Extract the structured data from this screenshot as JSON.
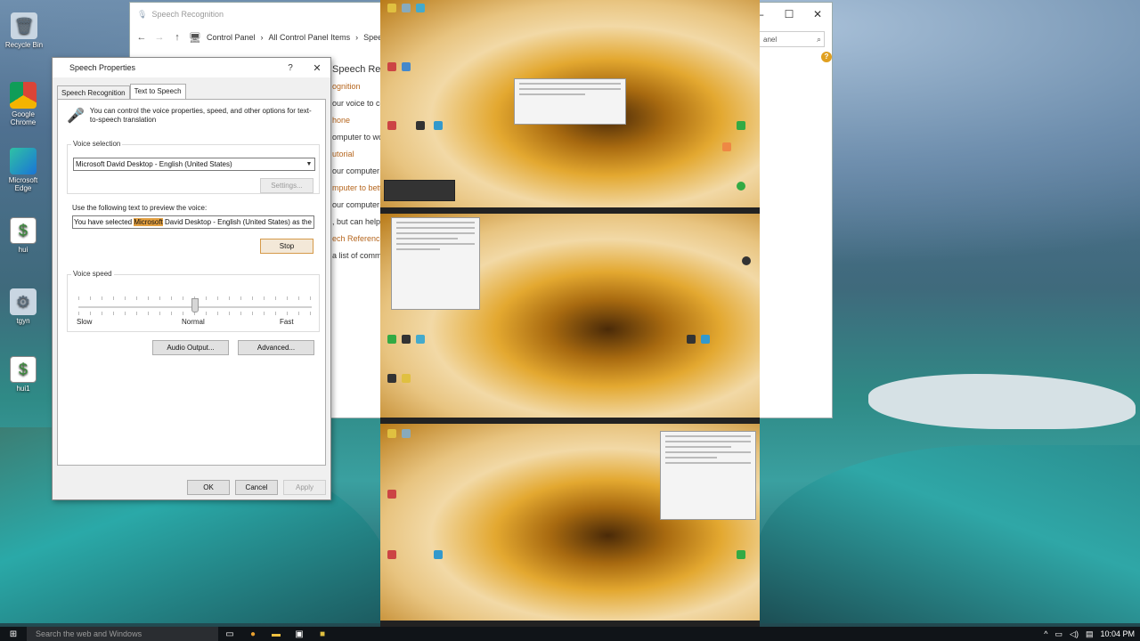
{
  "desktop": {
    "icons": [
      {
        "label": "Recycle Bin",
        "glyph": "🗑"
      },
      {
        "label": "Google Chrome",
        "glyph": ""
      },
      {
        "label": "Microsoft Edge",
        "glyph": ""
      },
      {
        "label": "hui",
        "glyph": "$"
      },
      {
        "label": "tgyn",
        "glyph": "⚙"
      },
      {
        "label": "hui1",
        "glyph": "$"
      }
    ]
  },
  "control_panel": {
    "title": "Speech Recognition",
    "breadcrumb": [
      "Control Panel",
      "All Control Panel Items",
      "Speech"
    ],
    "search_placeholder": "anel",
    "links": [
      {
        "text": "Speech Reco",
        "kind": "hd"
      },
      {
        "text": "ognition",
        "kind": "lk"
      },
      {
        "text": "our voice to contr",
        "kind": "tx"
      },
      {
        "text": "hone",
        "kind": "lk"
      },
      {
        "text": "omputer to work",
        "kind": "tx"
      },
      {
        "text": "utorial",
        "kind": "lk"
      },
      {
        "text": "our computer w",
        "kind": "tx"
      },
      {
        "text": "mputer to better",
        "kind": "lk"
      },
      {
        "text": "our computer to",
        "kind": "tx"
      },
      {
        "text": ", but can help i",
        "kind": "tx"
      },
      {
        "text": "ech Reference C",
        "kind": "lk"
      },
      {
        "text": "a list of comm",
        "kind": "tx"
      }
    ]
  },
  "speech_properties": {
    "title": "Speech Properties",
    "help": "?",
    "close": "✕",
    "tabs": [
      "Speech Recognition",
      "Text to Speech"
    ],
    "active_tab": 1,
    "intro": "You can control the voice properties, speed, and other options for text-to-speech translation",
    "voice_selection_label": "Voice selection",
    "voice_selected": "Microsoft David Desktop - English (United States)",
    "settings_button": "Settings...",
    "preview_label": "Use the following text to preview the voice:",
    "preview_text_before": "You have selected ",
    "preview_text_highlight": "Microsoft",
    "preview_text_after": " David Desktop - English (United States) as the computer",
    "stop_button": "Stop",
    "voice_speed_label": "Voice speed",
    "speed_value": 0.5,
    "speed_labels": [
      "Slow",
      "Normal",
      "Fast"
    ],
    "audio_output_button": "Audio Output...",
    "advanced_button": "Advanced...",
    "ok_button": "OK",
    "cancel_button": "Cancel",
    "apply_button": "Apply"
  },
  "taskbar": {
    "search_placeholder": "Search the web and Windows",
    "time": "10:04 PM"
  }
}
